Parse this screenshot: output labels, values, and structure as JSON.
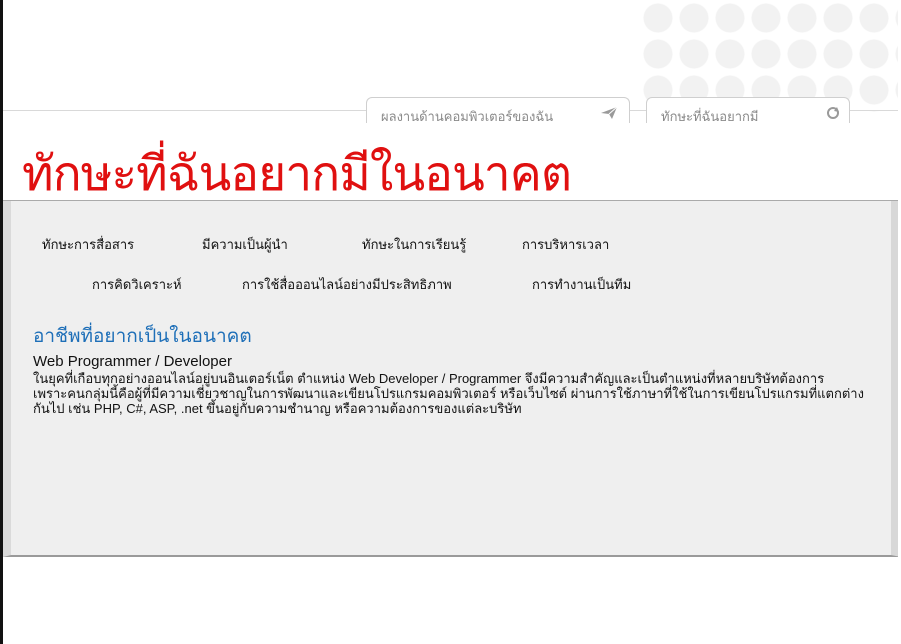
{
  "header": {
    "tabs": [
      {
        "label": "ผลงานด้านคอมพิวเตอร์ของฉัน",
        "icon": "paper-plane-icon"
      },
      {
        "label": "ทักษะที่ฉันอยากมี",
        "icon": "refresh-icon"
      }
    ]
  },
  "page": {
    "title": "ทักษะที่ฉันอยากมีในอนาคต"
  },
  "skills_nav": {
    "row1": [
      "ทักษะการสื่อสาร",
      "มีความเป็นผู้นำ",
      "ทักษะในการเรียนรู้",
      "การบริหารเวลา"
    ],
    "row2": [
      "การคิดวิเคราะห์",
      "การใช้สื่อออนไลน์อย่างมีประสิทธิภาพ",
      "การทำงานเป็นทีม"
    ]
  },
  "career": {
    "heading": "อาชีพที่อยากเป็นในอนาคต",
    "job_title": "Web Programmer / Developer",
    "description_lines": [
      "ในยุคที่เกือบทุกอย่างออนไลน์อยู่บนอินเตอร์เน็ต ตำแหน่ง Web Developer / Programmer จึงมีความสำคัญและเป็นตำแหน่งที่หลายบริษัทต้องการ",
      "เพราะคนกลุ่มนี้คือผู้ที่มีความเชี่ยวชาญในการพัฒนาและเขียนโปรแกรมคอมพิวเตอร์ หรือเว็บไซต์ ผ่านการใช้ภาษาที่ใช้ในการเขียนโปรแกรมที่แตกต่าง",
      "กันไป เช่น PHP, C#, ASP, .net ขึ้นอยู่กับความชำนาญ หรือความต้องการของแต่ละบริษัท"
    ]
  },
  "colors": {
    "title": "#e01010",
    "heading": "#1e6fb8",
    "content_bg": "#efefef"
  }
}
